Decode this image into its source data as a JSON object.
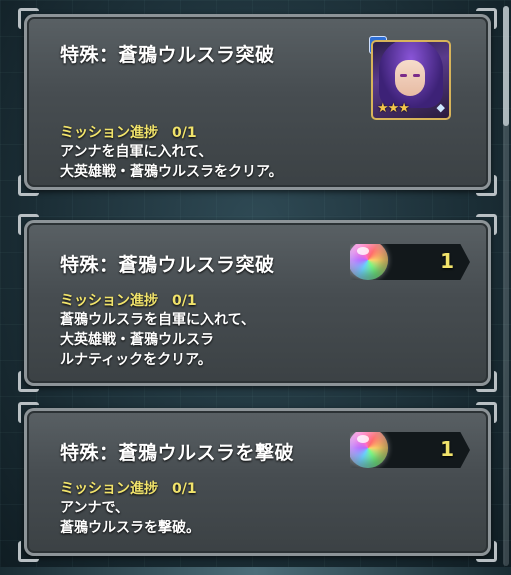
{
  "missions": [
    {
      "title": "特殊：蒼鴉ウルスラ突破",
      "progress_label": "ミッション進捗",
      "progress_value": "0/1",
      "description": [
        "アンナを自軍に入れて、",
        "大英雄戦・蒼鴉ウルスラをクリア。"
      ],
      "reward": {
        "type": "hero",
        "icon": "hero-portrait",
        "rarity_stars": 3,
        "stars_text": "★★★"
      }
    },
    {
      "title": "特殊：蒼鴉ウルスラ突破",
      "progress_label": "ミッション進捗",
      "progress_value": "0/1",
      "description": [
        "蒼鴉ウルスラを自軍に入れて、",
        "大英雄戦・蒼鴉ウルスラ",
        "ルナティックをクリア。"
      ],
      "reward": {
        "type": "orb",
        "icon": "orb-icon",
        "count": "1"
      }
    },
    {
      "title": "特殊：蒼鴉ウルスラを撃破",
      "progress_label": "ミッション進捗",
      "progress_value": "0/1",
      "description": [
        "アンナで、",
        "蒼鴉ウルスラを撃破。"
      ],
      "reward": {
        "type": "orb",
        "icon": "orb-icon",
        "count": "1"
      }
    }
  ],
  "colors": {
    "progress": "#f1e36b",
    "text": "#ffffff",
    "card": "#474d51"
  }
}
